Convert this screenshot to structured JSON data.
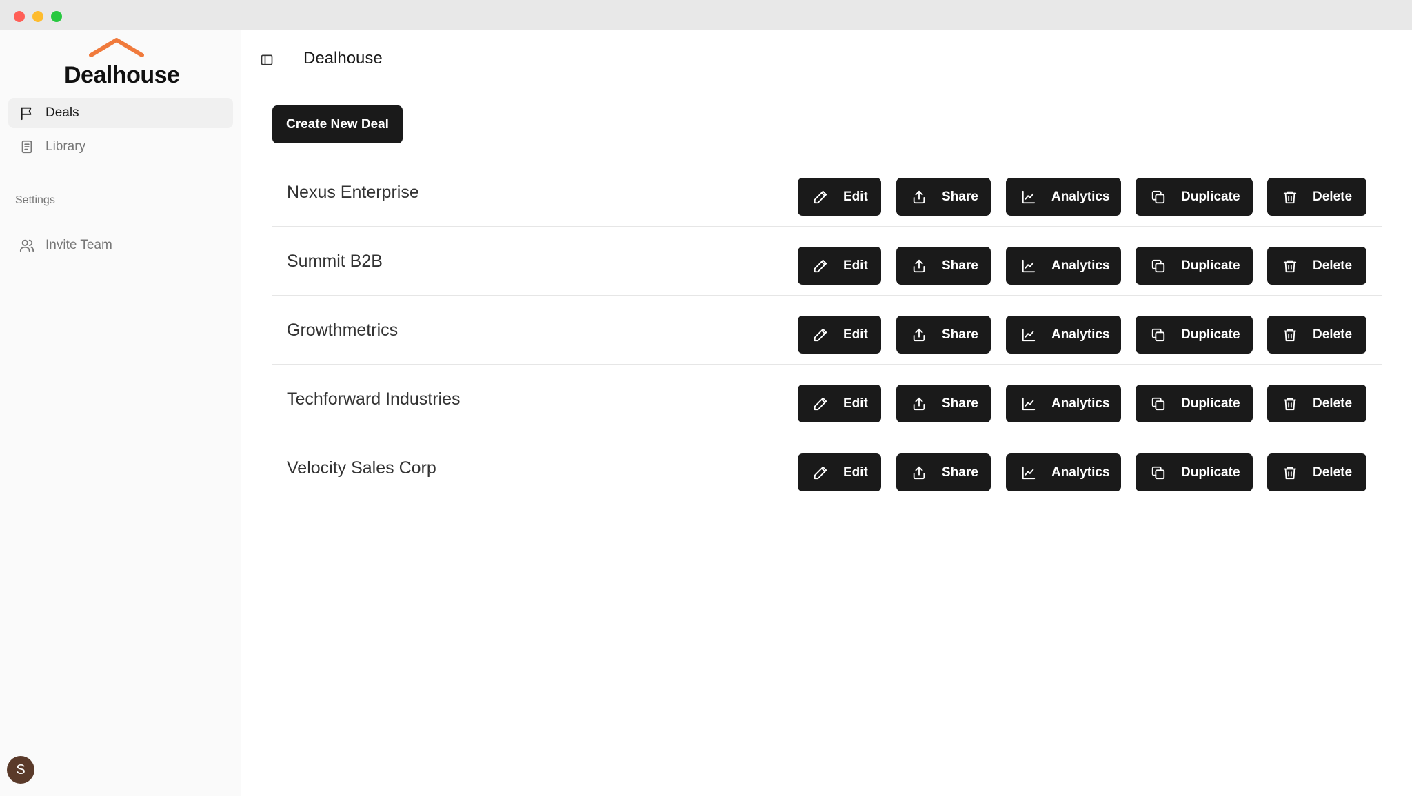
{
  "app": {
    "brand": "Dealhouse",
    "accent_color": "#f07a3c",
    "button_color": "#1a1a1a"
  },
  "sidebar": {
    "nav": [
      {
        "label": "Deals",
        "icon": "flag-icon",
        "active": true
      },
      {
        "label": "Library",
        "icon": "document-icon",
        "active": false
      }
    ],
    "settings_label": "Settings",
    "settings_items": [
      {
        "label": "Invite Team",
        "icon": "users-icon"
      }
    ],
    "avatar_initial": "S"
  },
  "header": {
    "title": "Dealhouse"
  },
  "main": {
    "create_button_label": "Create New Deal",
    "action_labels": {
      "edit": "Edit",
      "share": "Share",
      "analytics": "Analytics",
      "duplicate": "Duplicate",
      "delete": "Delete"
    },
    "deals": [
      {
        "name": "Nexus Enterprise"
      },
      {
        "name": "Summit B2B"
      },
      {
        "name": "Growthmetrics"
      },
      {
        "name": "Techforward Industries"
      },
      {
        "name": "Velocity Sales Corp"
      }
    ]
  }
}
